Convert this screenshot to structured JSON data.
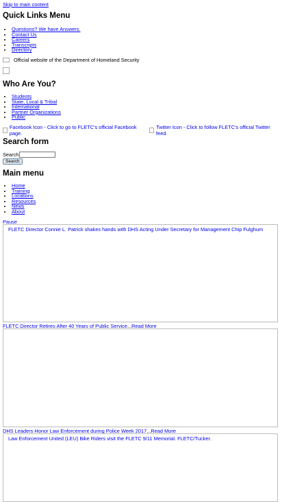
{
  "skip_link": "Skip to main content",
  "quick_links": {
    "heading": "Quick Links Menu",
    "items": [
      {
        "label": "Questions? We have Answers."
      },
      {
        "label": "Contact Us"
      },
      {
        "label": "Careers"
      },
      {
        "label": "Transcripts"
      },
      {
        "label": "Directory"
      }
    ]
  },
  "official_notice": "Official website of the Department of Homeland Security",
  "who_are_you": {
    "heading": "Who Are You?",
    "items": [
      {
        "label": "Students"
      },
      {
        "label": "State, Local & Tribal"
      },
      {
        "label": "International"
      },
      {
        "label": "Partner Organizations"
      },
      {
        "label": "Public"
      }
    ]
  },
  "social": {
    "facebook_alt": "Facebook Icon - Click to go to FLETC's official Facebook page.",
    "twitter_alt": "Twitter Icon - Click to follow FLETC's official Twitter feed."
  },
  "search": {
    "heading": "Search form",
    "label": "Search",
    "button_label": "Search",
    "value": ""
  },
  "main_menu": {
    "heading": "Main menu",
    "items": [
      {
        "label": "Home"
      },
      {
        "label": "Training"
      },
      {
        "label": "Locations"
      },
      {
        "label": "Resources"
      },
      {
        "label": "News"
      },
      {
        "label": "About"
      }
    ]
  },
  "slideshow": {
    "pause_label": "Pause",
    "slides": [
      {
        "image_alt": "FLETC Director Connie L. Patrick shakes hands with DHS Acting Under Secretary for Management Chip Fulghum",
        "caption": "FLETC Director Retires After 40 Years of Public Service",
        "separator": "...",
        "read_more": "Read More"
      },
      {
        "image_alt": "",
        "caption": "DHS Leaders Honor Law Enforcement during Police Week 2017",
        "separator": "...",
        "read_more": "Read More"
      },
      {
        "image_alt": "Law Enforcement United (LEU) Bike Riders visit the FLETC 9/11 Memorial. FLETC/Tucker.",
        "caption": "",
        "separator": "",
        "read_more": ""
      }
    ]
  }
}
